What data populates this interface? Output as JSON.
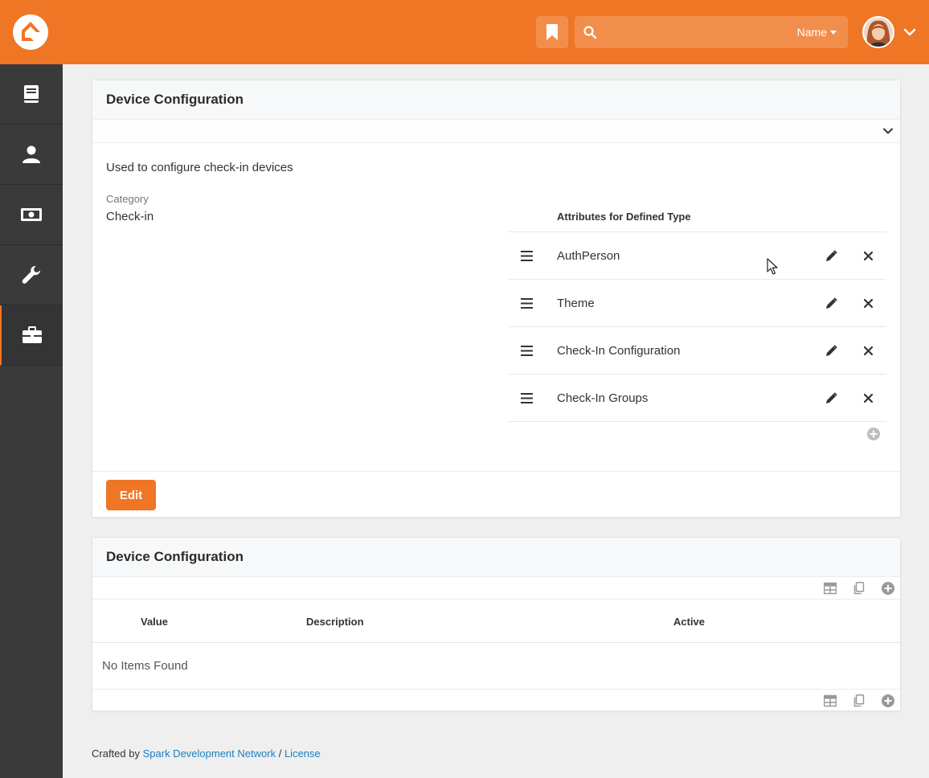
{
  "header": {
    "search": {
      "placeholder": "",
      "filter_label": "Name"
    },
    "icons": {
      "logo": "rock-logo",
      "bookmark": "bookmark-icon",
      "search": "search-icon",
      "user_menu": "chevron-down-icon"
    }
  },
  "sidebar": {
    "items": [
      {
        "icon": "book-icon",
        "active": false
      },
      {
        "icon": "person-icon",
        "active": false
      },
      {
        "icon": "money-icon",
        "active": false
      },
      {
        "icon": "wrench-icon",
        "active": false
      },
      {
        "icon": "briefcase-icon",
        "active": true
      }
    ]
  },
  "detail_panel": {
    "title": "Device Configuration",
    "description": "Used to configure check-in devices",
    "category_label": "Category",
    "category_value": "Check-in",
    "attributes_header": "Attributes for Defined Type",
    "attributes": [
      {
        "name": "AuthPerson"
      },
      {
        "name": "Theme"
      },
      {
        "name": "Check-In Configuration"
      },
      {
        "name": "Check-In Groups"
      }
    ],
    "edit_label": "Edit"
  },
  "values_panel": {
    "title": "Device Configuration",
    "columns": {
      "value": "Value",
      "description": "Description",
      "active": "Active"
    },
    "empty_text": "No Items Found"
  },
  "footer": {
    "prefix": "Crafted by",
    "link1": "Spark Development Network",
    "separator": "/",
    "link2": "License"
  },
  "colors": {
    "brand": "#ee7625",
    "sidebar": "#3a3a3a",
    "link": "#1a7fc1",
    "background": "#efefef"
  }
}
